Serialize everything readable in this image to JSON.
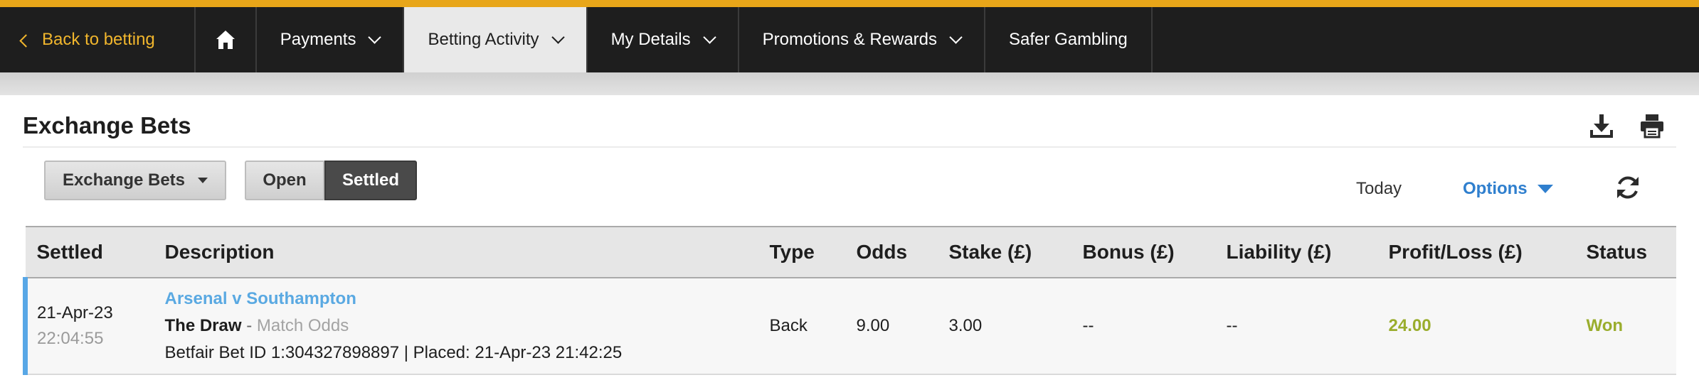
{
  "nav": {
    "back_label": "Back to betting",
    "items": [
      {
        "label": "Payments"
      },
      {
        "label": "Betting Activity"
      },
      {
        "label": "My Details"
      },
      {
        "label": "Promotions & Rewards"
      },
      {
        "label": "Safer Gambling"
      }
    ],
    "accent_color": "#e8a619"
  },
  "page": {
    "title": "Exchange Bets"
  },
  "controls": {
    "bet_type_dropdown": "Exchange Bets",
    "filter_open": "Open",
    "filter_settled": "Settled",
    "period": "Today",
    "options_label": "Options"
  },
  "table": {
    "columns": [
      "Settled",
      "Description",
      "Type",
      "Odds",
      "Stake (£)",
      "Bonus (£)",
      "Liability (£)",
      "Profit/Loss (£)",
      "Status"
    ],
    "rows": [
      {
        "date": "21-Apr-23",
        "time": "22:04:55",
        "event": "Arsenal v Southampton",
        "selection": "The Draw",
        "separator": " - ",
        "market": "Match Odds",
        "bet_info": "Betfair Bet ID 1:304327898897 | Placed: 21-Apr-23 21:42:25",
        "type": "Back",
        "odds": "9.00",
        "stake": "3.00",
        "bonus": "--",
        "liability": "--",
        "profit_loss": "24.00",
        "status": "Won"
      }
    ]
  },
  "icons": {
    "home": "home-icon",
    "download": "download-icon",
    "print": "print-icon",
    "refresh": "refresh-icon"
  }
}
